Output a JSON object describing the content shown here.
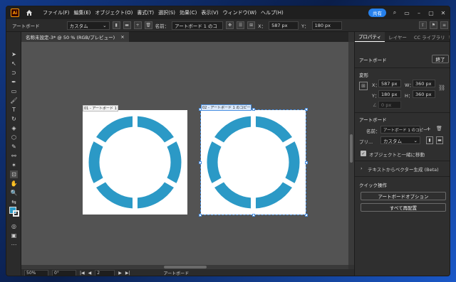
{
  "app": {
    "logo": "Ai",
    "share_label": "共有"
  },
  "menu": [
    "ファイル(F)",
    "編集(E)",
    "オブジェクト(O)",
    "書式(T)",
    "選択(S)",
    "効果(C)",
    "表示(V)",
    "ウィンドウ(W)",
    "ヘルプ(H)"
  ],
  "control_bar": {
    "context_label": "アートボード",
    "preset_value": "カスタム",
    "name_label": "名前：",
    "name_value": "アートボード 1 のコ",
    "x_label": "X：",
    "x_value": "587 px",
    "y_label": "Y：",
    "y_value": "180 px"
  },
  "document_tab": {
    "title": "名称未設定-3* @ 50 % (RGB/プレビュー)",
    "close": "×"
  },
  "artboards": [
    {
      "label": "01 - アートボード 1"
    },
    {
      "label": "02 - アートボード 1 のコピー"
    }
  ],
  "colors": {
    "ring": "#2b99c6",
    "accent": "#4a90e2",
    "fill_swatch": "#2b99c6"
  },
  "status_bar": {
    "zoom": "50%",
    "rotation": "0°",
    "artboard_index": "2",
    "mode": "アートボード"
  },
  "panel": {
    "tabs": [
      "プロパティ",
      "レイヤー",
      "CC ライブラリ"
    ],
    "context": "アートボード",
    "done_button": "終了",
    "transform_title": "変形",
    "x_label": "X：",
    "x_value": "587 px",
    "y_label": "Y：",
    "y_value": "180 px",
    "w_label": "W：",
    "w_value": "360 px",
    "h_label": "H：",
    "h_value": "360 px",
    "angle_value": "0 px",
    "artboard_title": "アートボード",
    "name_label": "名前：",
    "name_value": "アートボード 1 のコピー",
    "preset_label": "プリ...",
    "preset_value": "カスタム",
    "move_with_artwork": "オブジェクトと一緒に移動",
    "text_to_vector": "テキストからベクター生成 (Beta)",
    "quick_actions_title": "クイック操作",
    "artboard_options_button": "アートボードオプション",
    "rearrange_all_button": "すべて再配置"
  }
}
